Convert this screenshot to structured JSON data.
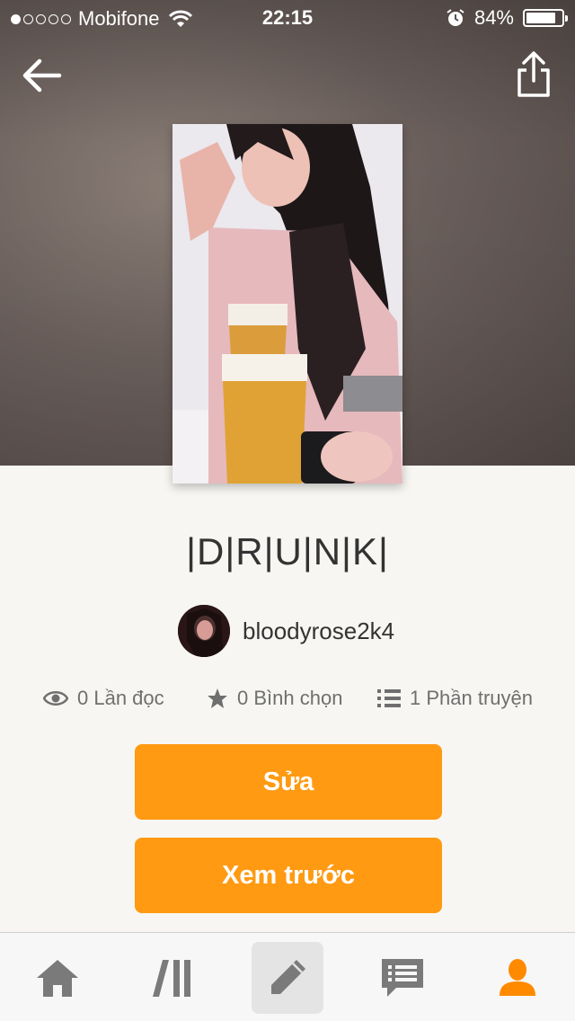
{
  "status_bar": {
    "carrier": "Mobifone",
    "time": "22:15",
    "battery": "84%",
    "battery_level": 0.84
  },
  "header": {
    "back_icon": "arrow-left-icon",
    "share_icon": "share-icon"
  },
  "story": {
    "title": "|D|R|U|N|K|",
    "author": "bloodyrose2k4",
    "stats": {
      "reads_label": "0 Lần đọc",
      "votes_label": "0 Bình chọn",
      "parts_label": "1 Phần truyện"
    }
  },
  "actions": {
    "edit_label": "Sửa",
    "preview_label": "Xem trước"
  },
  "colors": {
    "accent": "#ff9a12",
    "active_tab": "#ff8a00",
    "inactive_tab": "#7a7a7a"
  },
  "tabbar": {
    "items": [
      {
        "icon": "home-icon"
      },
      {
        "icon": "library-icon"
      },
      {
        "icon": "pencil-icon"
      },
      {
        "icon": "messages-icon"
      },
      {
        "icon": "profile-icon"
      }
    ]
  }
}
